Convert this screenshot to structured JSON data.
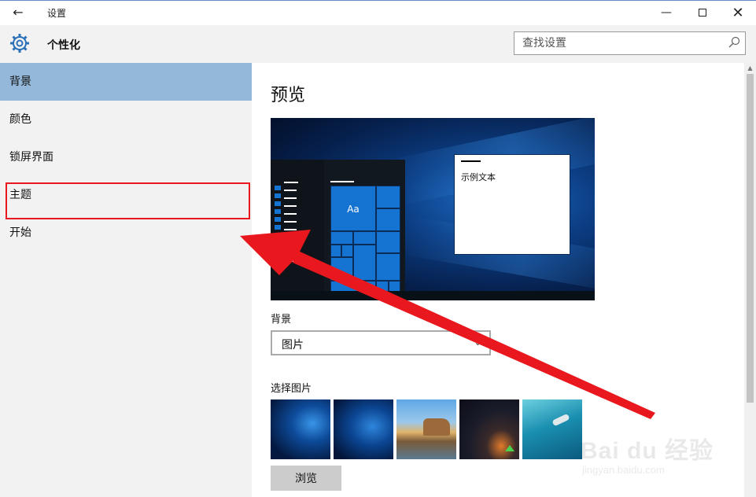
{
  "window": {
    "title": "设置",
    "back_icon": "←",
    "minimize_icon": "—",
    "close_icon": "✕"
  },
  "header": {
    "page_title": "个性化",
    "search_placeholder": "查找设置"
  },
  "sidebar": {
    "items": [
      {
        "label": "背景",
        "selected": true
      },
      {
        "label": "颜色"
      },
      {
        "label": "锁屏界面"
      },
      {
        "label": "主题",
        "highlighted": true
      },
      {
        "label": "开始"
      }
    ]
  },
  "main": {
    "preview_title": "预览",
    "preview": {
      "tile_text": "Aa",
      "sample_text": "示例文本"
    },
    "background_label": "背景",
    "background_value": "图片",
    "choose_picture_label": "选择图片",
    "browse_label": "浏览"
  },
  "watermark": {
    "brand": "Bai du 经验",
    "url": "jingyan.baidu.com"
  },
  "colors": {
    "selected_nav": "#94b8d9",
    "highlight_box": "#e8181e",
    "arrow": "#e8181e",
    "accent_blue": "#1573d1"
  }
}
